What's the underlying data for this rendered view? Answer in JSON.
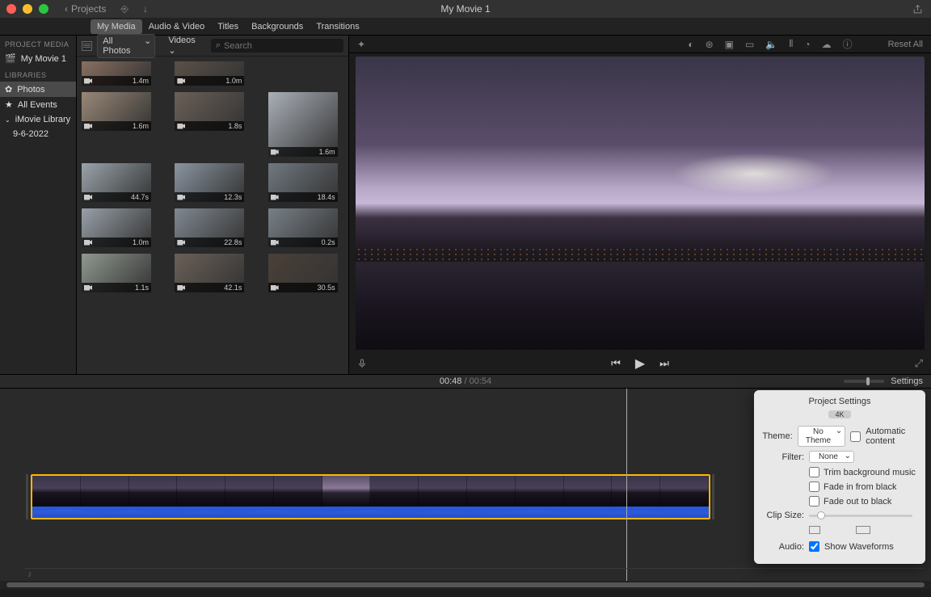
{
  "title": "My Movie 1",
  "back_label": "Projects",
  "tabs": [
    "My Media",
    "Audio & Video",
    "Titles",
    "Backgrounds",
    "Transitions"
  ],
  "active_tab": 0,
  "sidebar": {
    "project_media_hdr": "PROJECT MEDIA",
    "project_name": "My Movie 1",
    "libraries_hdr": "LIBRARIES",
    "items": [
      "Photos",
      "All Events",
      "iMovie Library",
      "9-6-2022"
    ],
    "selected": "Photos"
  },
  "browsebar": {
    "source": "All Photos",
    "filter": "Videos",
    "search_placeholder": "Search"
  },
  "thumbs": [
    {
      "dur": "1.4m",
      "h": "short"
    },
    {
      "dur": "1.0m",
      "h": "short"
    },
    {
      "dur": "",
      "h": ""
    },
    {
      "dur": "1.6m",
      "h": ""
    },
    {
      "dur": "1.8s",
      "h": ""
    },
    {
      "dur": "1.6m",
      "h": "tall"
    },
    {
      "dur": "44.7s",
      "h": ""
    },
    {
      "dur": "12.3s",
      "h": ""
    },
    {
      "dur": "18.4s",
      "h": ""
    },
    {
      "dur": "1.0m",
      "h": ""
    },
    {
      "dur": "22.8s",
      "h": ""
    },
    {
      "dur": "0.2s",
      "h": ""
    },
    {
      "dur": "1.1s",
      "h": ""
    },
    {
      "dur": "42.1s",
      "h": ""
    },
    {
      "dur": "30.5s",
      "h": ""
    }
  ],
  "viewer_toolbar_right": "Reset All",
  "time": {
    "current": "00:48",
    "total": "00:54"
  },
  "settings_label": "Settings",
  "popover": {
    "title": "Project Settings",
    "resolution": "4K",
    "theme_label": "Theme:",
    "theme_value": "No Theme",
    "auto_label": "Automatic content",
    "filter_label": "Filter:",
    "filter_value": "None",
    "trim_label": "Trim background music",
    "fadein_label": "Fade in from black",
    "fadeout_label": "Fade out to black",
    "clipsize_label": "Clip Size:",
    "audio_label": "Audio:",
    "waveforms_label": "Show Waveforms"
  }
}
